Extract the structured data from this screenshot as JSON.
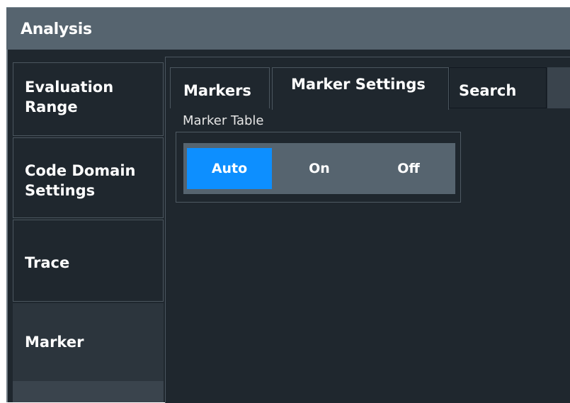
{
  "window": {
    "title": "Analysis"
  },
  "sidebar": {
    "items": [
      {
        "label_line1": "Evaluation",
        "label_line2": "Range"
      },
      {
        "label_line1": "Code Domain",
        "label_line2": "Settings"
      },
      {
        "label_line1": "Trace"
      },
      {
        "label_line1": "Marker"
      }
    ]
  },
  "tabs": {
    "items": [
      {
        "label": "Markers"
      },
      {
        "label": "Marker Settings"
      },
      {
        "label": "Search"
      }
    ]
  },
  "marker_table": {
    "title": "Marker Table",
    "options": [
      "Auto",
      "On",
      "Off"
    ],
    "selected": "Auto"
  },
  "colors": {
    "selected_accent": "#0d8fff",
    "titlebar": "#56646f",
    "background": "#1f272e"
  }
}
